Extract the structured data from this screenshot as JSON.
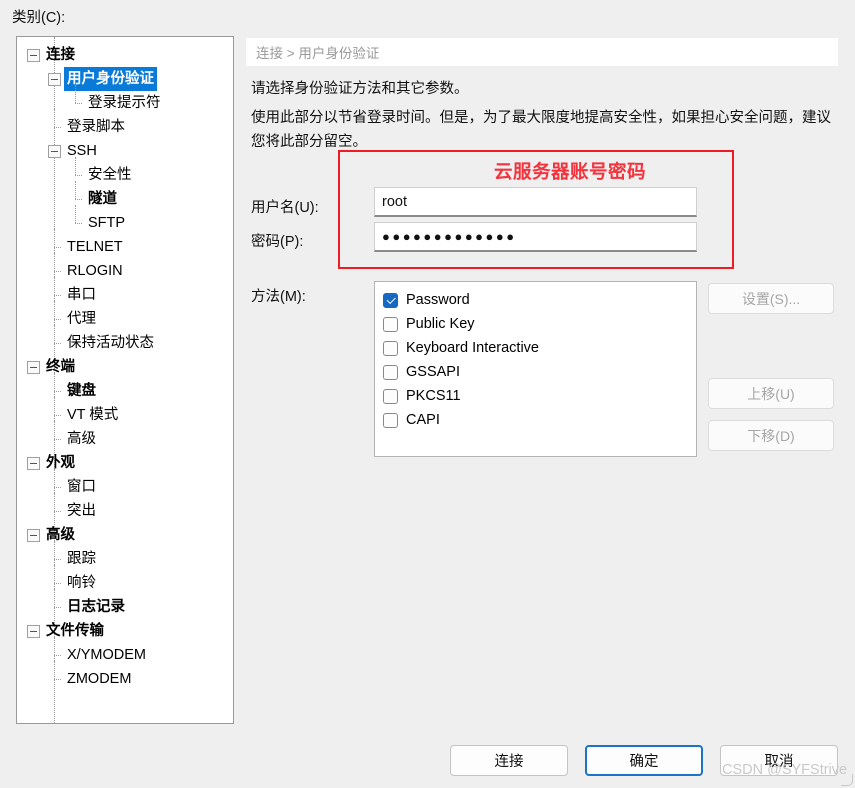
{
  "dialog": {
    "category_label": "类别(C):",
    "breadcrumb": "连接 > 用户身份验证",
    "description_line1": "请选择身份验证方法和其它参数。",
    "description_line2": "使用此部分以节省登录时间。但是，为了最大限度地提高安全性，如果担心安全问题，建议您将此部分留空。",
    "watermark": "CSDN @SYFStrive"
  },
  "annotation": {
    "text": "云服务器账号密码",
    "color": "#f4333d",
    "border_color": "#ee1c25"
  },
  "tree": {
    "selected": "用户身份验证",
    "selection_color": "#0a7ad8",
    "items": [
      {
        "label": "连接",
        "depth": 0,
        "expander": true,
        "bold": true,
        "selected": false
      },
      {
        "label": "用户身份验证",
        "depth": 1,
        "expander": true,
        "bold": true,
        "selected": true
      },
      {
        "label": "登录提示符",
        "depth": 2,
        "expander": false,
        "bold": false,
        "selected": false
      },
      {
        "label": "登录脚本",
        "depth": 1,
        "expander": false,
        "bold": false,
        "selected": false
      },
      {
        "label": "SSH",
        "depth": 1,
        "expander": true,
        "bold": false,
        "selected": false
      },
      {
        "label": "安全性",
        "depth": 2,
        "expander": false,
        "bold": false,
        "selected": false
      },
      {
        "label": "隧道",
        "depth": 2,
        "expander": false,
        "bold": true,
        "selected": false
      },
      {
        "label": "SFTP",
        "depth": 2,
        "expander": false,
        "bold": false,
        "selected": false
      },
      {
        "label": "TELNET",
        "depth": 1,
        "expander": false,
        "bold": false,
        "selected": false
      },
      {
        "label": "RLOGIN",
        "depth": 1,
        "expander": false,
        "bold": false,
        "selected": false
      },
      {
        "label": "串口",
        "depth": 1,
        "expander": false,
        "bold": false,
        "selected": false
      },
      {
        "label": "代理",
        "depth": 1,
        "expander": false,
        "bold": false,
        "selected": false
      },
      {
        "label": "保持活动状态",
        "depth": 1,
        "expander": false,
        "bold": false,
        "selected": false
      },
      {
        "label": "终端",
        "depth": 0,
        "expander": true,
        "bold": true,
        "selected": false
      },
      {
        "label": "键盘",
        "depth": 1,
        "expander": false,
        "bold": true,
        "selected": false
      },
      {
        "label": "VT 模式",
        "depth": 1,
        "expander": false,
        "bold": false,
        "selected": false
      },
      {
        "label": "高级",
        "depth": 1,
        "expander": false,
        "bold": false,
        "selected": false
      },
      {
        "label": "外观",
        "depth": 0,
        "expander": true,
        "bold": true,
        "selected": false
      },
      {
        "label": "窗口",
        "depth": 1,
        "expander": false,
        "bold": false,
        "selected": false
      },
      {
        "label": "突出",
        "depth": 1,
        "expander": false,
        "bold": false,
        "selected": false
      },
      {
        "label": "高级",
        "depth": 0,
        "expander": true,
        "bold": true,
        "selected": false
      },
      {
        "label": "跟踪",
        "depth": 1,
        "expander": false,
        "bold": false,
        "selected": false
      },
      {
        "label": "响铃",
        "depth": 1,
        "expander": false,
        "bold": false,
        "selected": false
      },
      {
        "label": "日志记录",
        "depth": 1,
        "expander": false,
        "bold": true,
        "selected": false
      },
      {
        "label": "文件传输",
        "depth": 0,
        "expander": true,
        "bold": true,
        "selected": false
      },
      {
        "label": "X/YMODEM",
        "depth": 1,
        "expander": false,
        "bold": false,
        "selected": false
      },
      {
        "label": "ZMODEM",
        "depth": 1,
        "expander": false,
        "bold": false,
        "selected": false
      }
    ]
  },
  "form": {
    "username_label": "用户名(U):",
    "username_value": "root",
    "username_placeholder": "",
    "password_label": "密码(P):",
    "password_value": "●●●●●●●●●●●●●",
    "password_placeholder": "",
    "methods_label": "方法(M):",
    "methods": [
      {
        "label": "Password",
        "checked": true
      },
      {
        "label": "Public Key",
        "checked": false
      },
      {
        "label": "Keyboard Interactive",
        "checked": false
      },
      {
        "label": "GSSAPI",
        "checked": false
      },
      {
        "label": "PKCS11",
        "checked": false
      },
      {
        "label": "CAPI",
        "checked": false
      }
    ]
  },
  "side_buttons": {
    "settings": "设置(S)...",
    "move_up": "上移(U)",
    "move_down": "下移(D)"
  },
  "bottom_buttons": {
    "connect": "连接",
    "ok": "确定",
    "cancel": "取消"
  }
}
